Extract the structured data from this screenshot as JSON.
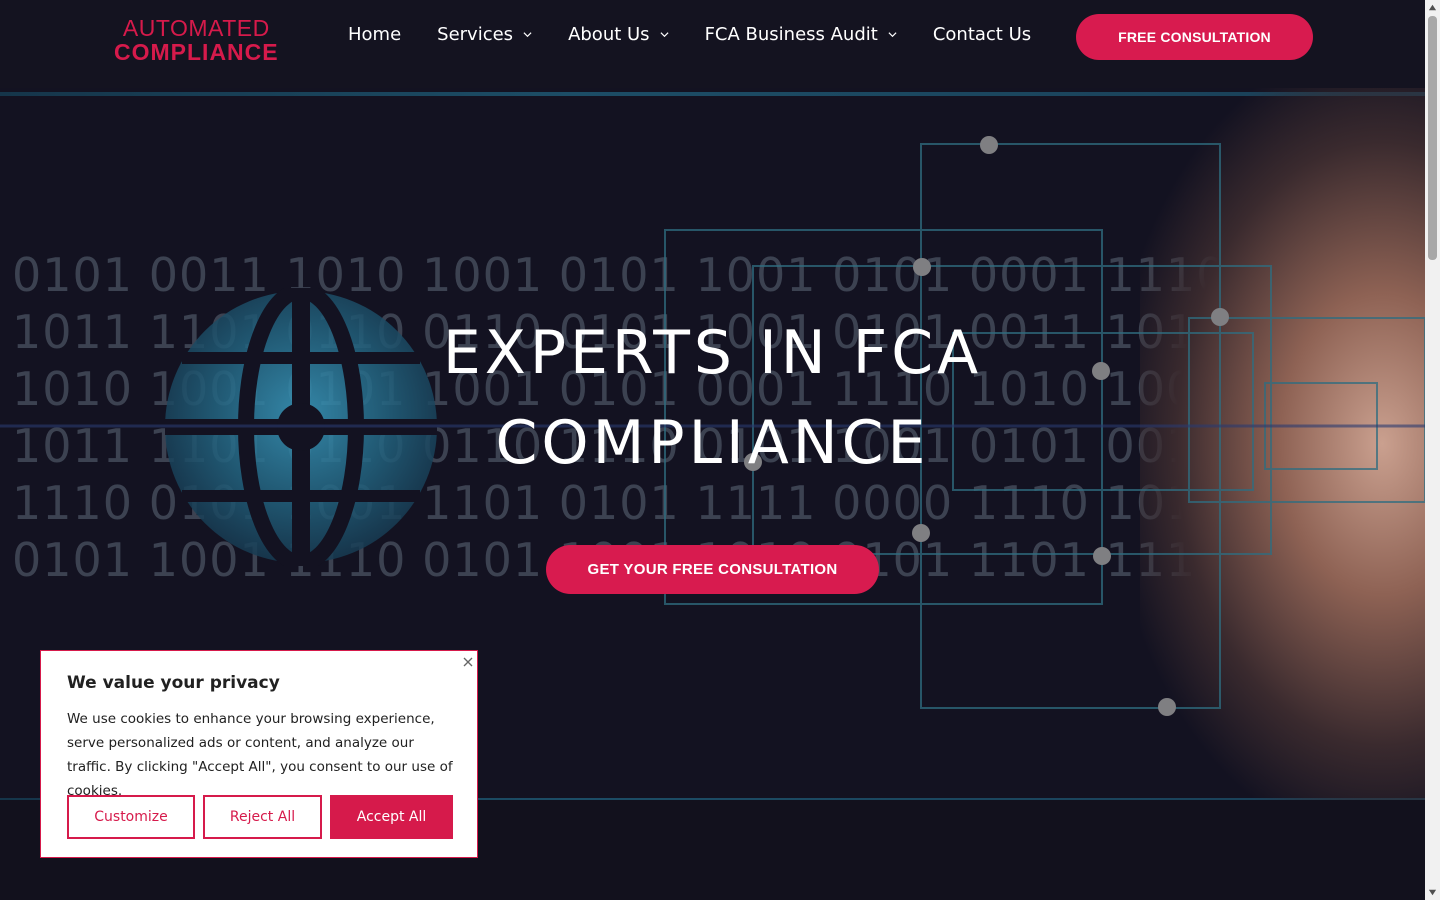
{
  "brand": {
    "line1": "AUTOMATED",
    "line2": "COMPLIANCE",
    "color": "#d61a4b"
  },
  "nav": {
    "items": [
      {
        "label": "Home",
        "has_dropdown": false
      },
      {
        "label": "Services",
        "has_dropdown": true
      },
      {
        "label": "About Us",
        "has_dropdown": true
      },
      {
        "label": "FCA Business Audit",
        "has_dropdown": true
      },
      {
        "label": "Contact Us",
        "has_dropdown": false
      }
    ],
    "cta_label": "FREE CONSULTATION"
  },
  "hero": {
    "title_line1": "EXPERTS IN FCA",
    "title_line2": "COMPLIANCE",
    "cta_label": "GET YOUR FREE CONSULTATION",
    "background_color": "#131221",
    "accent_color": "#d81b4f"
  },
  "cookie": {
    "title": "We value your privacy",
    "text": "We use cookies to enhance your browsing experience, serve personalized ads or content, and analyze our traffic. By clicking \"Accept All\", you consent to our use of cookies.",
    "buttons": {
      "customize": "Customize",
      "reject": "Reject All",
      "accept": "Accept All"
    }
  }
}
